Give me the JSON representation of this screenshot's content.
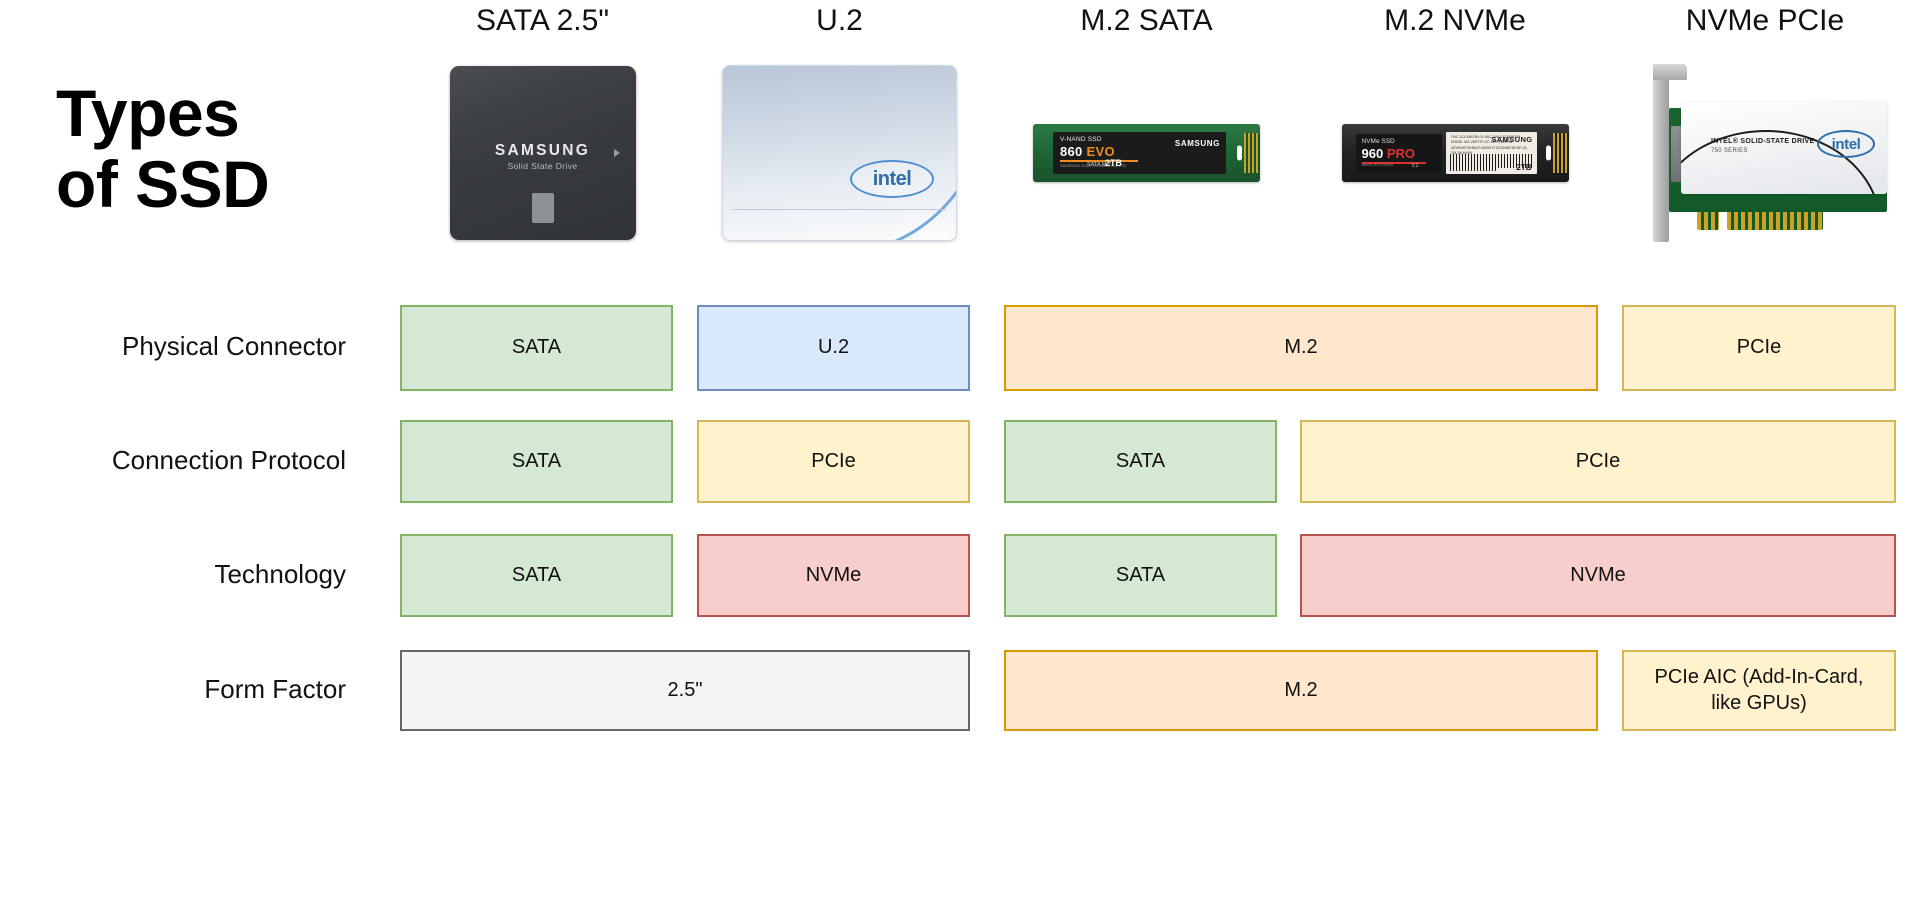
{
  "title": {
    "line1": "Types",
    "line2": "of SSD"
  },
  "columns": [
    {
      "label": "SATA 2.5\"",
      "product": "samsung-850-evo-2.5-inch-ssd"
    },
    {
      "label": "U.2",
      "product": "intel-u2-ssd"
    },
    {
      "label": "M.2 SATA",
      "product": "samsung-860-evo-m2-sata-ssd"
    },
    {
      "label": "M.2 NVMe",
      "product": "samsung-960-pro-m2-nvme-ssd"
    },
    {
      "label": "NVMe PCIe",
      "product": "intel-750-series-pcie-add-in-card"
    }
  ],
  "product_labels": {
    "sata25": {
      "brand": "SAMSUNG",
      "sub": "Solid State Drive"
    },
    "u2": {
      "brand": "intel"
    },
    "m2sata": {
      "nand": "V-NAND SSD",
      "model": "860 ",
      "model_accent": "EVO",
      "interface": "SATA M.2",
      "capacity": "2TB",
      "brand": "SAMSUNG",
      "fine": "SAMSUNG ELECTRONICS CO. LTD"
    },
    "m2nvme": {
      "nvme": "NVMe SSD",
      "model": "960 ",
      "model_accent": "PRO",
      "version": "V.2",
      "capacity": "2TB",
      "brand": "SAMSUNG",
      "fine": "MADE IN KOREA",
      "sticker_text": "TMC 123-456789-01 MLC  S/N 0123456789  MODEL MZ-V6P2T0  DC 12V 1.8A  P/N MZVKW2T0HMLP-00000  R 0123456789 RF-01-234-56-NV99"
    },
    "aic": {
      "t1": "INTEL® SOLID-STATE DRIVE",
      "t2": "750 SERIES",
      "brand": "intel"
    }
  },
  "table": {
    "rows": [
      {
        "label": "Physical Connector",
        "cells": [
          {
            "text": "SATA",
            "color": "green",
            "span": 1
          },
          {
            "text": "U.2",
            "color": "blue",
            "span": 1
          },
          {
            "text": "M.2",
            "color": "orange",
            "span": 2
          },
          {
            "text": "PCIe",
            "color": "yellow",
            "span": 1
          }
        ]
      },
      {
        "label": "Connection Protocol",
        "cells": [
          {
            "text": "SATA",
            "color": "green",
            "span": 1
          },
          {
            "text": "PCIe",
            "color": "yellow",
            "span": 1
          },
          {
            "text": "SATA",
            "color": "green",
            "span": 1
          },
          {
            "text": "PCIe",
            "color": "yellow",
            "span": 2
          }
        ]
      },
      {
        "label": "Technology",
        "cells": [
          {
            "text": "SATA",
            "color": "green",
            "span": 1
          },
          {
            "text": "NVMe",
            "color": "red",
            "span": 1
          },
          {
            "text": "SATA",
            "color": "green",
            "span": 1
          },
          {
            "text": "NVMe",
            "color": "red",
            "span": 2
          }
        ]
      },
      {
        "label": "Form Factor",
        "cells": [
          {
            "text": "2.5\"",
            "color": "gray",
            "span": 2
          },
          {
            "text": "M.2",
            "color": "orange",
            "span": 2
          },
          {
            "text": "PCIe AIC (Add-In-Card,\nlike GPUs)",
            "color": "yellow",
            "span": 1
          }
        ]
      }
    ]
  },
  "colors": {
    "green_fill": "#d5e8d4",
    "green_border": "#82b366",
    "blue_fill": "#dae8fc",
    "blue_border": "#6c8ebf",
    "orange_fill": "#ffe6cc",
    "orange_border": "#d79b00",
    "yellow_fill": "#fff2cc",
    "yellow_border": "#d6b656",
    "red_fill": "#f8cecc",
    "red_border": "#b85450",
    "gray_fill": "#f5f5f5",
    "gray_border": "#666666",
    "background": "#ffffff",
    "text": "#111111"
  }
}
